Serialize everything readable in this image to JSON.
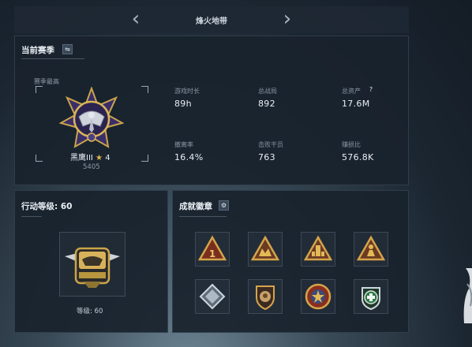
{
  "header": {
    "title": "烽火地带",
    "prev_icon": "chevron-left-icon",
    "next_icon": "chevron-right-icon"
  },
  "season": {
    "title": "当前赛季",
    "toggle_icon": "swap-icon",
    "highest_label": "赛季最高",
    "rank_name": "黑鹰III",
    "rank_stars": "4",
    "rank_points": "5405",
    "stats": [
      {
        "label": "游戏时长",
        "value": "89h"
      },
      {
        "label": "总战局",
        "value": "892"
      },
      {
        "label": "总资产",
        "value": "17.6M",
        "help": "?"
      },
      {
        "label": "撤离率",
        "value": "16.4%"
      },
      {
        "label": "击败干员",
        "value": "763"
      },
      {
        "label": "赚损比",
        "value": "576.8K"
      }
    ]
  },
  "action_level": {
    "title": "行动等级: 60",
    "level_text": "等级: 60"
  },
  "achievements": {
    "title": "成就徽章",
    "settings_icon": "gear-icon",
    "badges": [
      {
        "name": "badge-triangle-1"
      },
      {
        "name": "badge-triangle-hands"
      },
      {
        "name": "badge-triangle-tower"
      },
      {
        "name": "badge-triangle-figure"
      },
      {
        "name": "badge-diamond"
      },
      {
        "name": "badge-shield-lion"
      },
      {
        "name": "badge-star-emblem"
      },
      {
        "name": "badge-medical-cross"
      }
    ]
  }
}
